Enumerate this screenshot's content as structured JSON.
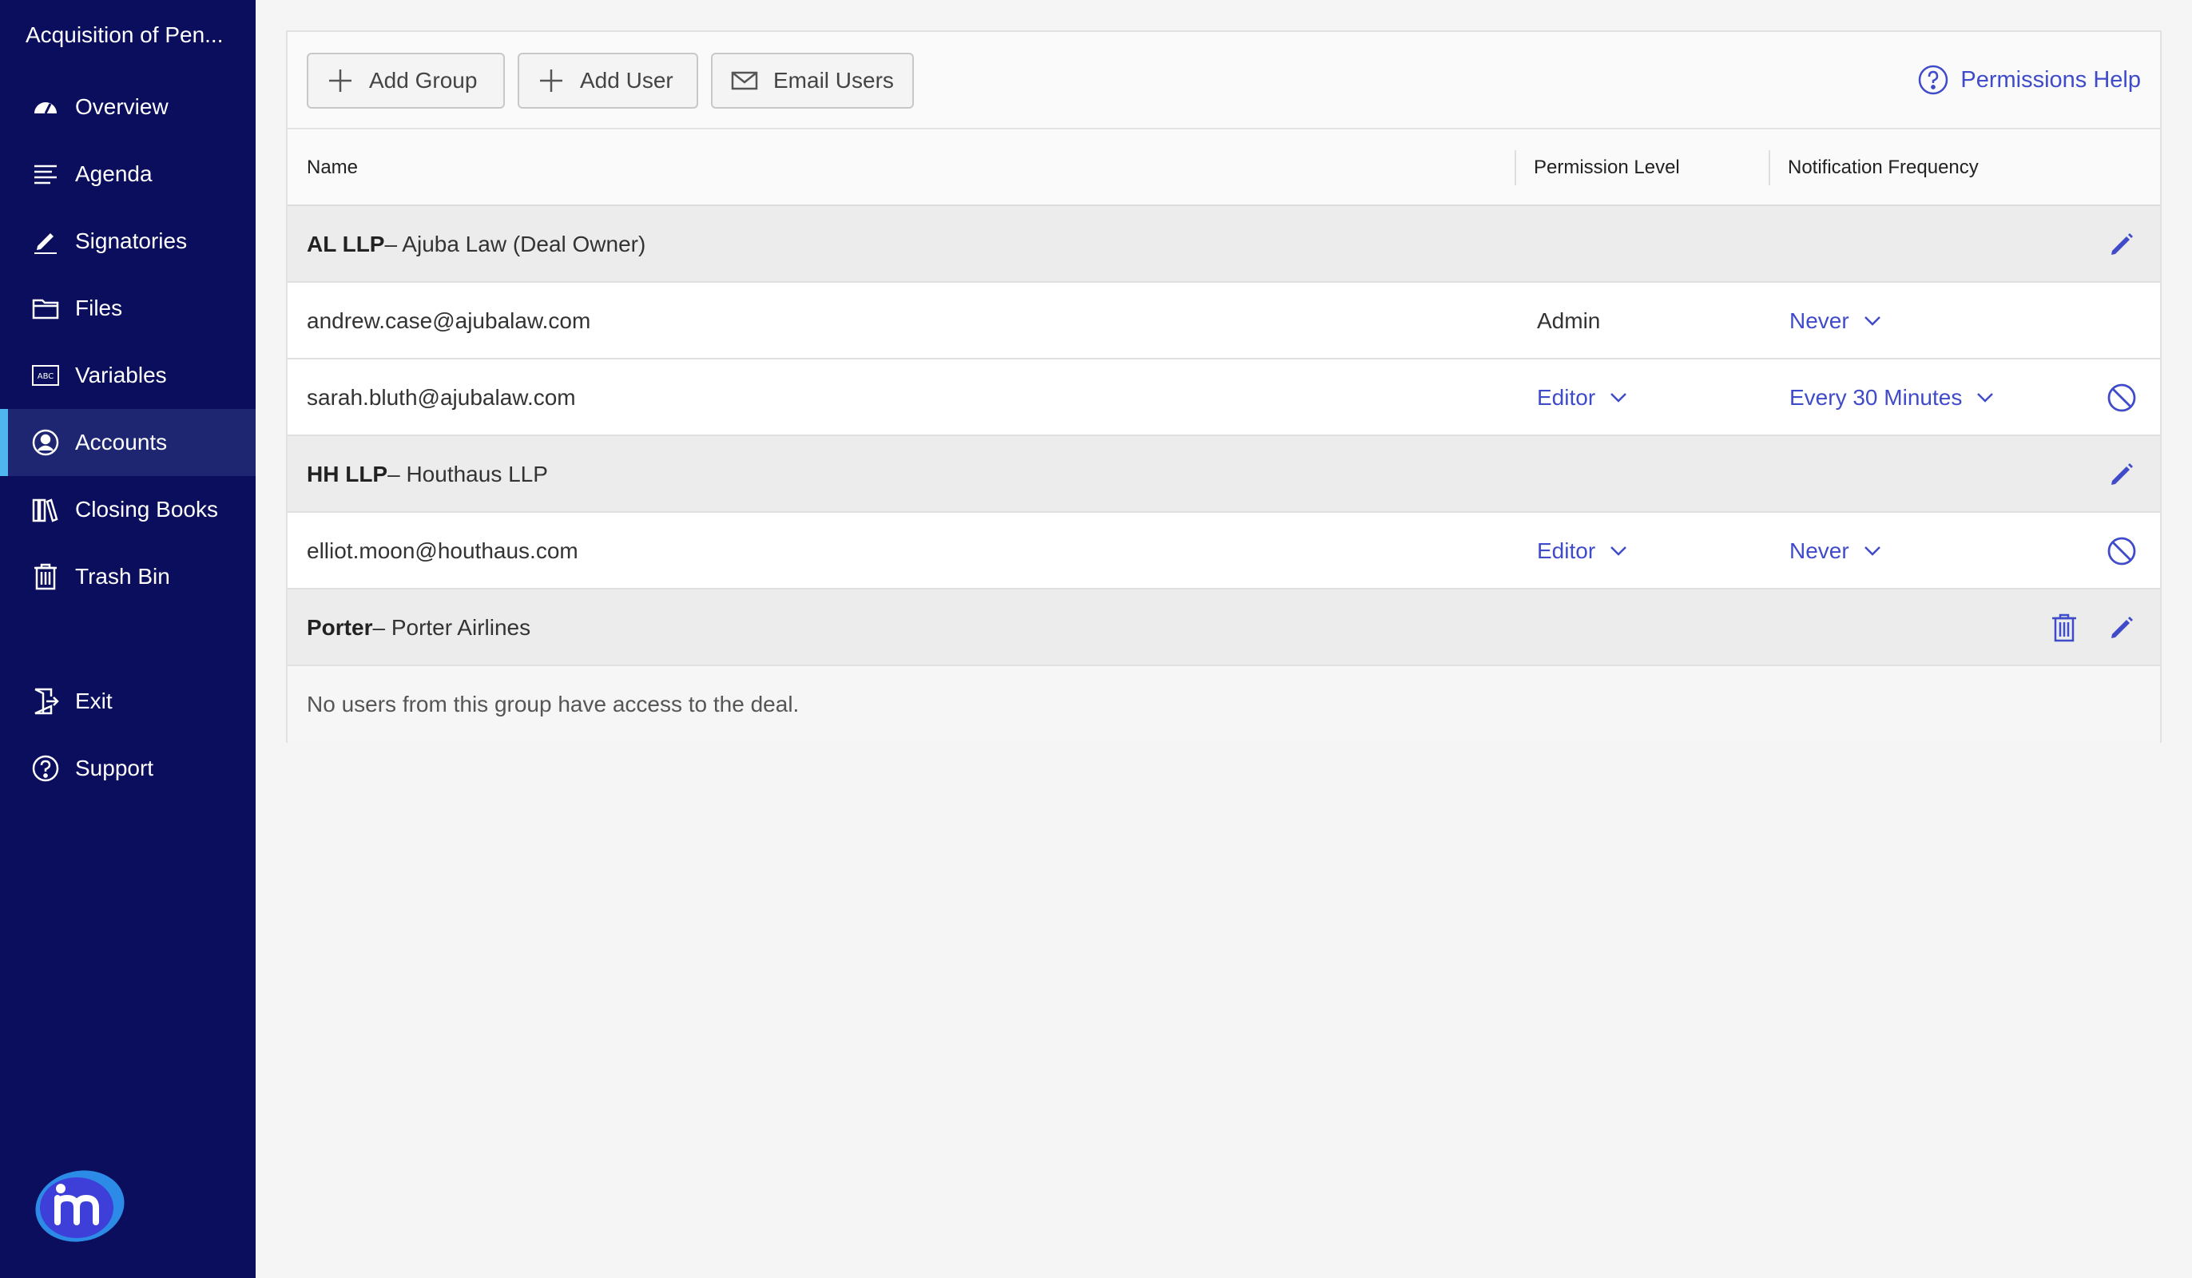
{
  "sidebar": {
    "deal_title": "Acquisition of Pen...",
    "items": [
      {
        "label": "Overview",
        "icon": "gauge-icon"
      },
      {
        "label": "Agenda",
        "icon": "list-icon"
      },
      {
        "label": "Signatories",
        "icon": "pen-icon"
      },
      {
        "label": "Files",
        "icon": "folder-icon"
      },
      {
        "label": "Variables",
        "icon": "abc-icon"
      },
      {
        "label": "Accounts",
        "icon": "user-circle-icon",
        "active": true
      },
      {
        "label": "Closing Books",
        "icon": "books-icon"
      },
      {
        "label": "Trash Bin",
        "icon": "trash-icon"
      }
    ],
    "bottom_items": [
      {
        "label": "Exit",
        "icon": "exit-icon"
      },
      {
        "label": "Support",
        "icon": "help-circle-icon"
      }
    ]
  },
  "toolbar": {
    "add_group_label": "Add Group",
    "add_user_label": "Add User",
    "email_users_label": "Email Users",
    "help_label": "Permissions Help"
  },
  "table": {
    "columns": [
      "Name",
      "Permission Level",
      "Notification Frequency"
    ],
    "rows": [
      {
        "type": "group",
        "code": "AL LLP",
        "name": " – Ajuba Law (Deal Owner)"
      },
      {
        "type": "user",
        "email": "andrew.case@ajubalaw.com",
        "permission": "Admin",
        "frequency": "Never"
      },
      {
        "type": "user",
        "email": "sarah.bluth@ajubalaw.com",
        "permission": "Editor",
        "frequency": "Every 30 Minutes"
      },
      {
        "type": "group",
        "code": "HH LLP",
        "name": " – Houthaus LLP"
      },
      {
        "type": "user",
        "email": "elliot.moon@houthaus.com",
        "permission": "Editor",
        "frequency": "Never"
      },
      {
        "type": "group",
        "code": "Porter",
        "name": " – Porter Airlines"
      },
      {
        "type": "empty",
        "message": "No users from this group have access to the deal."
      }
    ]
  },
  "colors": {
    "sidebar_bg": "#0a0e5c",
    "active_accent": "#4fb6f0",
    "link": "#3f4bc8"
  }
}
